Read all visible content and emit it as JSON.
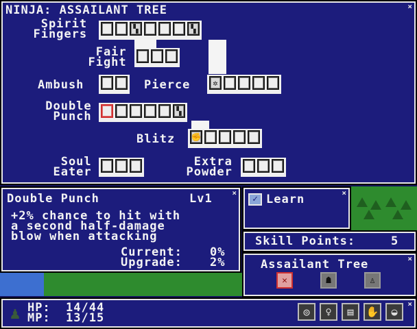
{
  "tree_panel": {
    "title": "NINJA: ASSAILANT TREE",
    "skills": [
      {
        "label": "Spirit\n  Fingers",
        "slots": 7
      },
      {
        "label": "Fair\n  Fight",
        "slots": 3
      },
      {
        "label": "Ambush",
        "slots": 2
      },
      {
        "label": "Pierce",
        "slots": 5
      },
      {
        "label": "Double\n  Punch",
        "slots": 6
      },
      {
        "label": "Blitz",
        "slots": 5
      },
      {
        "label": "Soul\n  Eater",
        "slots": 3
      },
      {
        "label": "Extra\n  Powder",
        "slots": 3
      }
    ]
  },
  "detail": {
    "name": "Double Punch",
    "level": "Lv1",
    "description": "+2% chance to hit with\na second half-damage\nblow when attacking",
    "current_label": "Current:",
    "current_value": "0%",
    "upgrade_label": "Upgrade:",
    "upgrade_value": "2%",
    "close": "×"
  },
  "learn": {
    "label": "Learn",
    "close": "×",
    "checked": true
  },
  "skill_points": {
    "label": "Skill Points:",
    "value": "5"
  },
  "tree_select": {
    "title": "Assailant Tree",
    "close": "×",
    "icons": [
      "crossed-swords-icon",
      "ghost-icon",
      "figure-icon"
    ]
  },
  "status": {
    "hp_label": "HP:",
    "hp": "14/44",
    "mp_label": "MP:",
    "mp": "13/15",
    "close": "×"
  },
  "colors": {
    "panel_bg": "#1c1c7c",
    "border": "#e8e8e8",
    "grass": "#2e8b2e",
    "water": "#3d6fd0",
    "active_slot": "#d03030"
  }
}
